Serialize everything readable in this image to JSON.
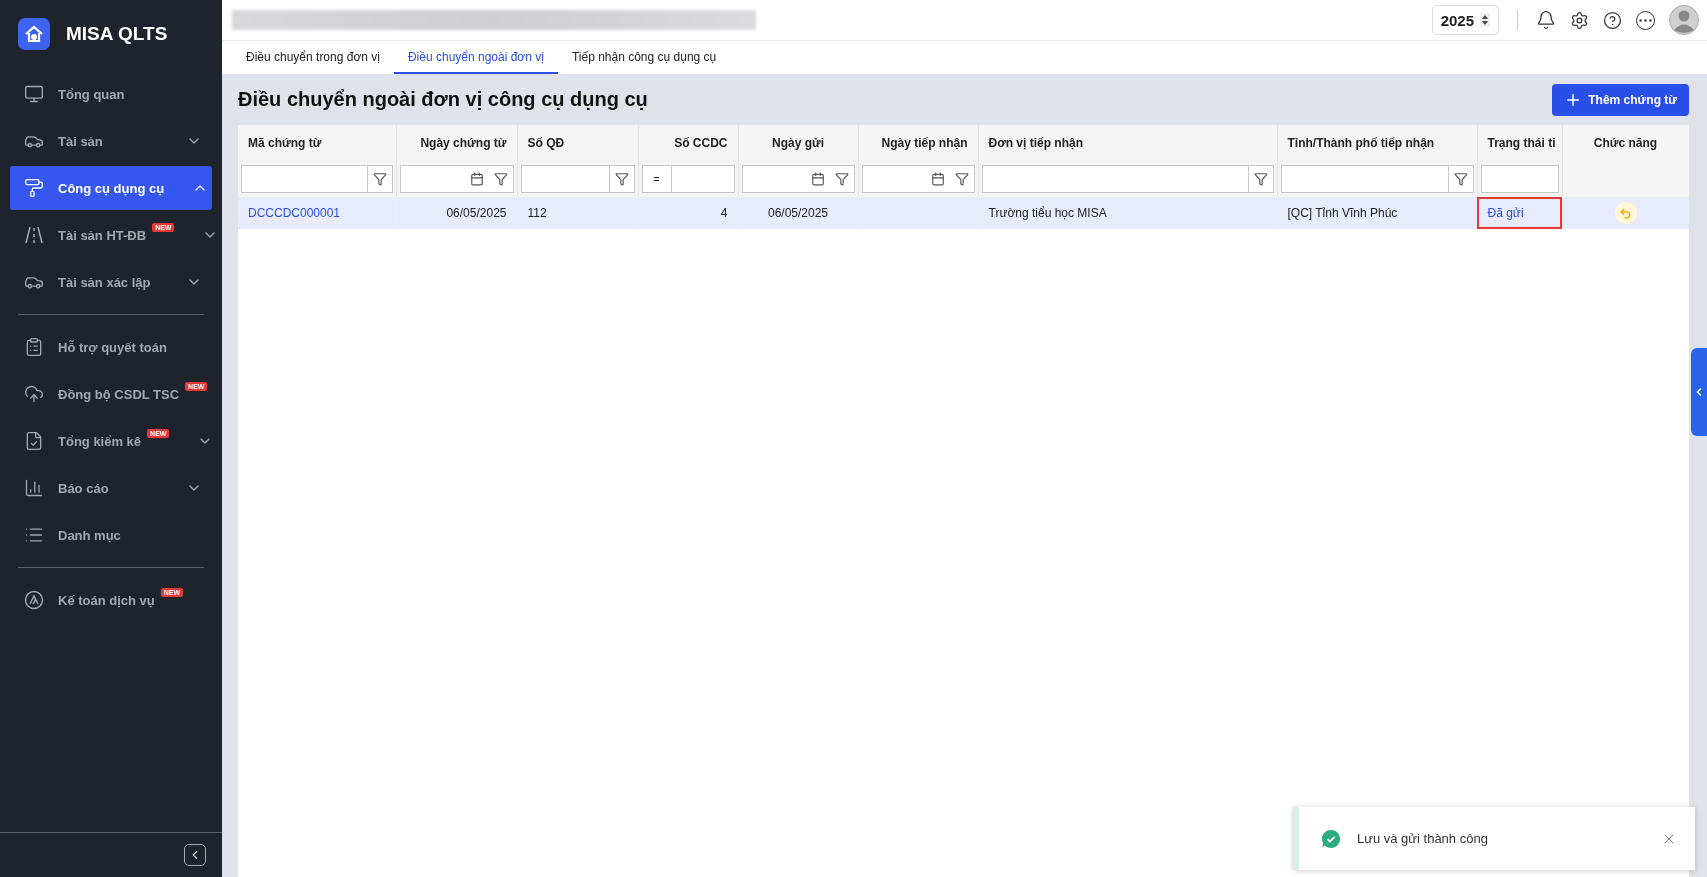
{
  "app": {
    "name": "MISA QLTS"
  },
  "sidebar": {
    "groups": [
      [
        {
          "label": "Tổng quan",
          "selected": false
        },
        {
          "label": "Tài sản",
          "selected": false,
          "expanded": false
        },
        {
          "label": "Công cụ dụng cụ",
          "selected": true,
          "expanded": true
        },
        {
          "label": "Tài sản HT-ĐB",
          "selected": false,
          "expanded": false,
          "badge": "NEW"
        },
        {
          "label": "Tài sản xác lập",
          "selected": false,
          "expanded": false
        }
      ],
      [
        {
          "label": "Hỗ trợ quyết toán",
          "selected": false
        },
        {
          "label": "Đồng bộ CSDL TSC",
          "selected": false,
          "badge": "NEW"
        },
        {
          "label": "Tổng kiểm kê",
          "selected": false,
          "expanded": false,
          "badge": "NEW"
        },
        {
          "label": "Báo cáo",
          "selected": false,
          "expanded": false
        },
        {
          "label": "Danh mục",
          "selected": false
        }
      ],
      [
        {
          "label": "Kế toán dịch vụ",
          "selected": false,
          "badge": "NEW"
        }
      ]
    ]
  },
  "header": {
    "year": "2025"
  },
  "tabs": [
    {
      "label": "Điều chuyển trong đơn vị",
      "selected": false
    },
    {
      "label": "Điều chuyển ngoài đơn vị",
      "selected": true
    },
    {
      "label": "Tiếp nhận công cụ dụng cụ",
      "selected": false
    }
  ],
  "page": {
    "title": "Điều chuyển ngoài đơn vị công cụ dụng cụ",
    "add_button": "Thêm chứng từ"
  },
  "table": {
    "columns": [
      {
        "label": "Mã chứng từ",
        "kind": "text"
      },
      {
        "label": "Ngày chứng từ",
        "kind": "date"
      },
      {
        "label": "Số QĐ",
        "kind": "text"
      },
      {
        "label": "Số CCDC",
        "kind": "number",
        "operator": "="
      },
      {
        "label": "Ngày gửi",
        "kind": "date"
      },
      {
        "label": "Ngày tiếp nhận",
        "kind": "date"
      },
      {
        "label": "Đơn vị tiếp nhận",
        "kind": "text"
      },
      {
        "label": "Tỉnh/Thành phố tiếp nhận",
        "kind": "text"
      },
      {
        "label": "Trạng thái ti",
        "kind": "plain"
      },
      {
        "label": "Chức năng",
        "kind": "none"
      }
    ],
    "rows": [
      {
        "selected": true,
        "cells": [
          {
            "kind": "link",
            "text": "DCCCDC000001"
          },
          {
            "kind": "text",
            "text": "06/05/2025"
          },
          {
            "kind": "text",
            "text": "112"
          },
          {
            "kind": "text",
            "text": "4"
          },
          {
            "kind": "text",
            "text": "06/05/2025"
          },
          {
            "kind": "empty"
          },
          {
            "kind": "text",
            "text": "Trường tiểu học MISA"
          },
          {
            "kind": "text",
            "text": "[QC] Tỉnh Vĩnh Phúc"
          },
          {
            "kind": "status",
            "text": "Đã gửi",
            "highlighted": true
          },
          {
            "kind": "action"
          }
        ]
      }
    ]
  },
  "toast": {
    "message": "Lưu và gửi thành công"
  }
}
